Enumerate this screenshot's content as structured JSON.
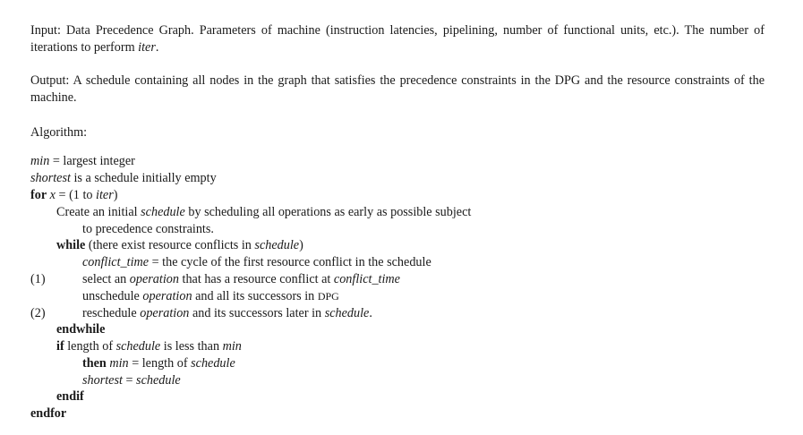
{
  "input": {
    "label": "Input:",
    "text_a": "Data Precedence Graph. Parameters of machine (instruction latencies, pipelining, number of functional units, etc.). The number of iterations to perform ",
    "iter": "iter",
    "end": "."
  },
  "output": {
    "label": "Output:",
    "text": "A schedule containing all nodes in the graph that satisfies the precedence constraints in the DPG and the resource constraints of the machine."
  },
  "algorithm_heading": "Algorithm:",
  "code": {
    "l1_var": "min",
    "l1_rest": " = largest integer",
    "l2_var": "shortest",
    "l2_rest": " is a schedule initially empty",
    "l3_kw": "for",
    "l3_x": "x",
    "l3_eq": " = (1 to ",
    "l3_iter": "iter",
    "l3_close": ")",
    "l4_a": "Create an initial ",
    "l4_sched": "schedule",
    "l4_b": " by scheduling all operations as early as possible subject",
    "l5": "to precedence constraints.",
    "l6_kw": "while",
    "l6_a": " (there exist resource conflicts in ",
    "l6_sched": "schedule",
    "l6_b": ")",
    "l7_var": "conflict_time",
    "l7_rest": " = the cycle of the first resource conflict in the schedule",
    "l8_a": "select an ",
    "l8_op": "operation",
    "l8_b": " that has a resource conflict at ",
    "l8_ct": "conflict_time",
    "l9_a": "unschedule ",
    "l9_op": "operation",
    "l9_b": " and all its successors in ",
    "l9_dpg": "DPG",
    "l10_a": "reschedule ",
    "l10_op": "operation",
    "l10_b": " and its successors later in ",
    "l10_sched": "schedule",
    "l10_c": ".",
    "l11_kw": "endwhile",
    "l12_kw": "if",
    "l12_a": " length of ",
    "l12_sched": "schedule",
    "l12_b": " is less than ",
    "l12_min": "min",
    "l13_kw": "then",
    "l13_min": "min",
    "l13_a": " = length of ",
    "l13_sched": "schedule",
    "l14_short": "shortest",
    "l14_eq": " = ",
    "l14_sched": "schedule",
    "l15_kw": "endif",
    "l16_kw": "endfor"
  },
  "markers": {
    "m1": "(1)",
    "m2": "(2)"
  }
}
